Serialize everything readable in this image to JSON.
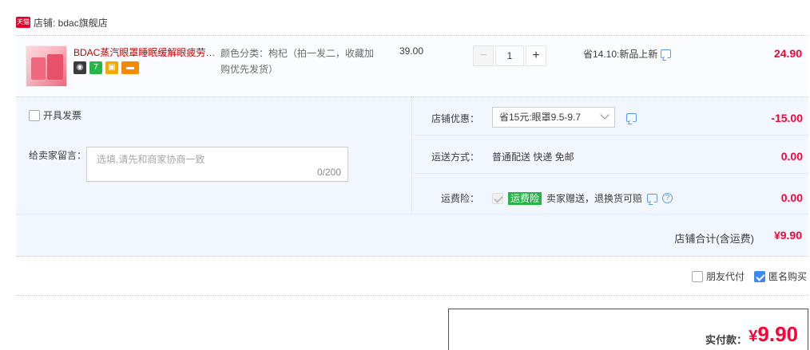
{
  "shop": {
    "badge": "天猫",
    "name": "店铺: bdac旗舰店"
  },
  "item": {
    "title": "BDAC蒸汽眼罩睡眠缓解眼疲劳…",
    "icons": [
      "tmall-cat-icon",
      "seven-day-return-icon",
      "gift-icon",
      "card-icon"
    ],
    "sku": "颜色分类：枸杞（拍一发二，收藏加购优先发货）",
    "unit_price": "39.00",
    "quantity": "1",
    "minus_label": "−",
    "plus_label": "+",
    "promo": "省14.10:新品上新",
    "subtotal": "24.90"
  },
  "options": {
    "invoice_label": "开具发票",
    "memo_label": "给卖家留言：",
    "memo_placeholder": "选填,请先和商家协商一致",
    "memo_count": "0/200",
    "discount_label": "店铺优惠：",
    "discount_selected": "省15元:眼罩9.5-9.7",
    "discount_amount": "-15.00",
    "shipping_label": "运送方式：",
    "shipping_value": "普通配送 快递 免邮",
    "shipping_amount": "0.00",
    "insurance_label": "运费险：",
    "insurance_tag": "运费险",
    "insurance_text": "卖家赠送，退换货可赔",
    "insurance_amount": "0.00"
  },
  "shop_total": {
    "label": "店铺合计(含运费)",
    "value": "¥9.90"
  },
  "pay_options": {
    "friend_pay": "朋友代付",
    "anonymous": "匿名购买",
    "anonymous_checked": true
  },
  "final": {
    "label": "实付款：",
    "currency": "¥",
    "amount": "9.90"
  },
  "colors": {
    "price_red": "#ff0036",
    "title_red": "#c40000",
    "panel_blue": "#f2f7ff",
    "accent_blue": "#3d8af7"
  }
}
